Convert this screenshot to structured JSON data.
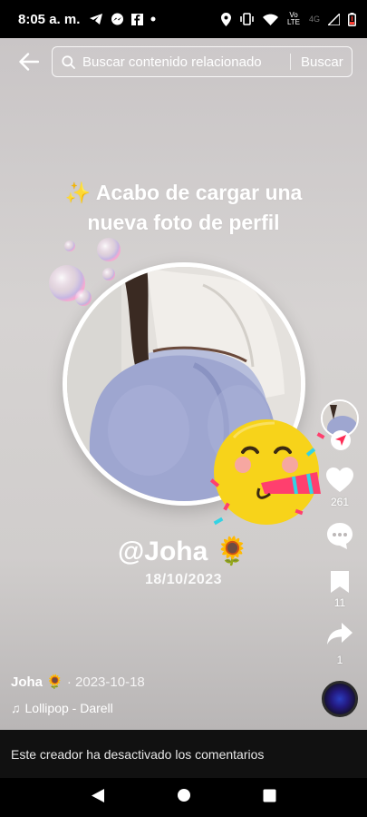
{
  "status": {
    "time": "8:05 a. m.",
    "network_label": "Vo LTE",
    "signal_label": "4G"
  },
  "search": {
    "placeholder": "Buscar contenido relacionado",
    "button_label": "Buscar"
  },
  "post": {
    "headline_line1": "✨ Acabo de cargar una",
    "headline_line2": "nueva foto de perfil",
    "handle": "@Joha 🌻",
    "date": "18/10/2023"
  },
  "actions": {
    "likes": "261",
    "saves": "11",
    "shares": "1"
  },
  "caption": {
    "author": "Joha 🌻",
    "date": "· 2023-10-18",
    "music": "Lollipop - Darell"
  },
  "comments_disabled_text": "Este creador ha desactivado los comentarios",
  "colors": {
    "accent": "#fe2c55",
    "emoji_yellow": "#f7d31a"
  }
}
